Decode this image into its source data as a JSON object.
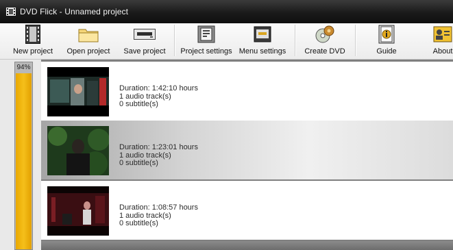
{
  "window": {
    "title": "DVD Flick - Unnamed project"
  },
  "toolbar": {
    "items": [
      {
        "label": "New project",
        "icon": "film-strip-icon"
      },
      {
        "label": "Open project",
        "icon": "folder-icon"
      },
      {
        "label": "Save project",
        "icon": "disk-drive-icon"
      },
      {
        "label": "Project settings",
        "icon": "settings-panel-icon"
      },
      {
        "label": "Menu settings",
        "icon": "menu-icon"
      },
      {
        "label": "Create DVD",
        "icon": "gears-disc-icon"
      },
      {
        "label": "Guide",
        "icon": "book-info-icon"
      },
      {
        "label": "About",
        "icon": "person-card-icon"
      }
    ]
  },
  "progress": {
    "label": "94%",
    "value": 0.94,
    "color": "#f2b51a"
  },
  "titles": [
    {
      "duration": "Duration: 1:42:10 hours",
      "audio": "1 audio track(s)",
      "subtitles": "0 subtitle(s)"
    },
    {
      "duration": "Duration: 1:23:01 hours",
      "audio": "1 audio track(s)",
      "subtitles": "0 subtitle(s)"
    },
    {
      "duration": "Duration: 1:08:57 hours",
      "audio": "1 audio track(s)",
      "subtitles": "0 subtitle(s)"
    }
  ]
}
